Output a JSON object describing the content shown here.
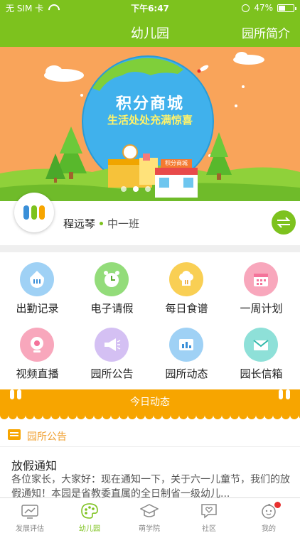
{
  "status_bar": {
    "carrier": "无 SIM 卡",
    "time": "下午6:47",
    "battery": "47%",
    "battery_level": 0.47
  },
  "header": {
    "title": "幼儿园",
    "right_link": "园所简介"
  },
  "banner": {
    "title": "积分商城",
    "subtitle": "生活处处充满惊喜",
    "shop_sign": "积分商城"
  },
  "profile": {
    "name": "程远琴",
    "class": "中一班"
  },
  "features": [
    {
      "label": "出勤记录",
      "icon": "attendance-icon",
      "color": "#9fd1f5"
    },
    {
      "label": "电子请假",
      "icon": "alarm-clock-icon",
      "color": "#93dc7a"
    },
    {
      "label": "每日食谱",
      "icon": "chef-hat-icon",
      "color": "#f9cf54"
    },
    {
      "label": "一周计划",
      "icon": "calendar-icon",
      "color": "#f8a7bc"
    },
    {
      "label": "视频直播",
      "icon": "camera-icon",
      "color": "#f8a7bc"
    },
    {
      "label": "园所公告",
      "icon": "megaphone-icon",
      "color": "#d4c0f3"
    },
    {
      "label": "园所动态",
      "icon": "dashboard-icon",
      "color": "#9fd1f5"
    },
    {
      "label": "园长信箱",
      "icon": "mail-icon",
      "color": "#8ee0d8"
    }
  ],
  "today_bar": {
    "label": "今日动态"
  },
  "notice": {
    "section_label": "园所公告",
    "title": "放假通知",
    "body": "各位家长，大家好：现在通知一下，关于六一儿童节，我们的放假通知！本园是省教委直属的全日制省一级幼儿..."
  },
  "tabs": [
    {
      "label": "发展评估",
      "icon": "tv-chart-icon",
      "active": false
    },
    {
      "label": "幼儿园",
      "icon": "palette-icon",
      "active": true
    },
    {
      "label": "萌学院",
      "icon": "graduation-cap-icon",
      "active": false
    },
    {
      "label": "社区",
      "icon": "chat-heart-icon",
      "active": false
    },
    {
      "label": "我的",
      "icon": "baby-face-icon",
      "active": false
    }
  ],
  "colors": {
    "brand_green": "#7dc21e",
    "accent_orange": "#f7a500",
    "banner_bg": "#f9a45a",
    "badge_red": "#e8302f"
  }
}
